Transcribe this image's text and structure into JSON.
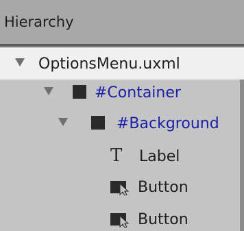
{
  "panel": {
    "title": "Hierarchy"
  },
  "tree": {
    "root": {
      "label": "OptionsMenu.uxml"
    },
    "container": {
      "label": "#Container"
    },
    "background": {
      "label": "#Background"
    },
    "label_item": {
      "label": "Label",
      "icon": "T"
    },
    "button1": {
      "label": "Button"
    },
    "button2": {
      "label": "Button"
    }
  },
  "colors": {
    "header_bg": "#a8a8a8",
    "panel_bg": "#c4c4c4",
    "selected_row_bg": "#f0f0f0",
    "selector_text": "#1b1fa8"
  }
}
